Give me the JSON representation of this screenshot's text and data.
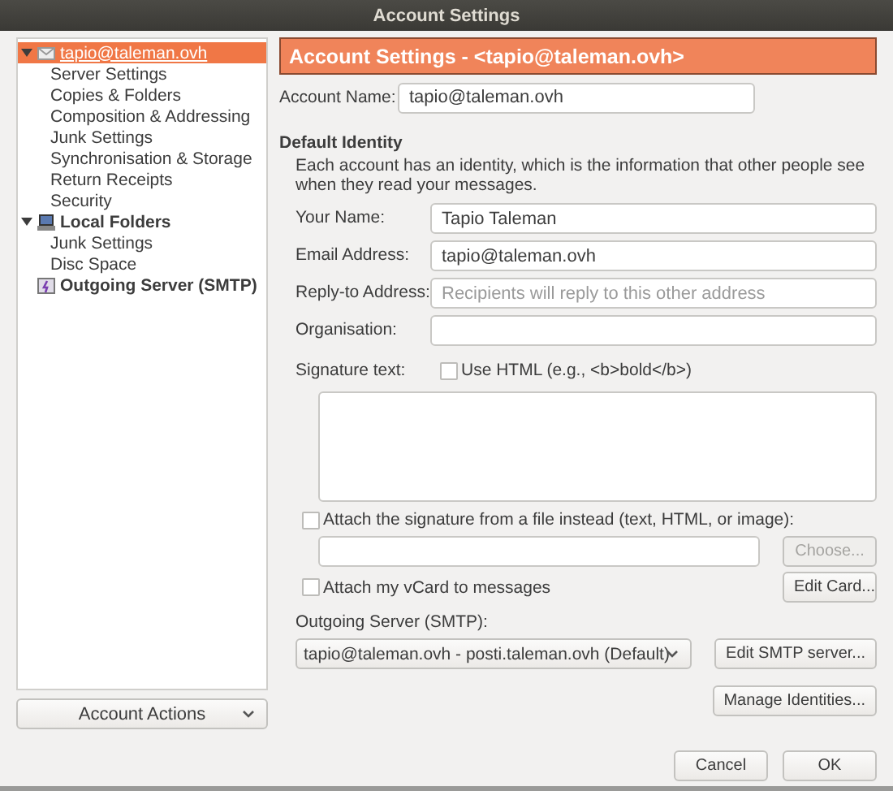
{
  "window": {
    "title": "Account Settings"
  },
  "sidebar": {
    "tree": [
      {
        "label": "tapio@taleman.ovh",
        "kind": "mail",
        "selected": true,
        "expanded": true,
        "children": [
          {
            "label": "Server Settings",
            "selected": false
          },
          {
            "label": "Copies & Folders",
            "selected": false
          },
          {
            "label": "Composition & Addressing",
            "selected": false
          },
          {
            "label": "Junk Settings",
            "selected": false
          },
          {
            "label": "Synchronisation & Storage",
            "selected": false
          },
          {
            "label": "Return Receipts",
            "selected": false
          },
          {
            "label": "Security",
            "selected": false
          }
        ]
      },
      {
        "label": "Local Folders",
        "kind": "computer",
        "selected": false,
        "expanded": true,
        "children": [
          {
            "label": "Junk Settings",
            "selected": false
          },
          {
            "label": "Disc Space",
            "selected": false
          }
        ]
      },
      {
        "label": "Outgoing Server (SMTP)",
        "kind": "server",
        "selected": false
      }
    ],
    "account_actions": "Account Actions"
  },
  "main": {
    "header": "Account Settings - <tapio@taleman.ovh>",
    "account_name": {
      "label": "Account Name:",
      "value": "tapio@taleman.ovh"
    },
    "default_identity": {
      "heading": "Default Identity",
      "description": "Each account has an identity, which is the information that other people see when they read your messages.",
      "fields": [
        {
          "label": "Your Name:",
          "value": "Tapio Taleman"
        },
        {
          "label": "Email Address:",
          "value": "tapio@taleman.ovh"
        },
        {
          "label": "Reply-to Address:",
          "placeholder": "Recipients will reply to this other address"
        },
        {
          "label": "Organisation:"
        }
      ]
    },
    "signature": {
      "label": "Signature text:",
      "use_html": {
        "label": "Use HTML (e.g., <b>bold</b>)",
        "checked": false
      }
    },
    "attach_file": {
      "label": "Attach the signature from a file instead (text, HTML, or image):",
      "checked": false
    },
    "choose_button": {
      "label": "Choose...",
      "disabled": true
    },
    "vcard": {
      "label": "Attach my vCard to messages",
      "checked": false
    },
    "edit_card_button": "Edit Card...",
    "outgoing_server": {
      "label": "Outgoing Server (SMTP):",
      "value": "tapio@taleman.ovh - posti.taleman.ovh (Default)"
    },
    "edit_smtp_button": "Edit SMTP server...",
    "manage_identities_button": "Manage Identities..."
  },
  "buttons": [
    {
      "label": "Cancel"
    },
    {
      "label": "OK"
    }
  ]
}
